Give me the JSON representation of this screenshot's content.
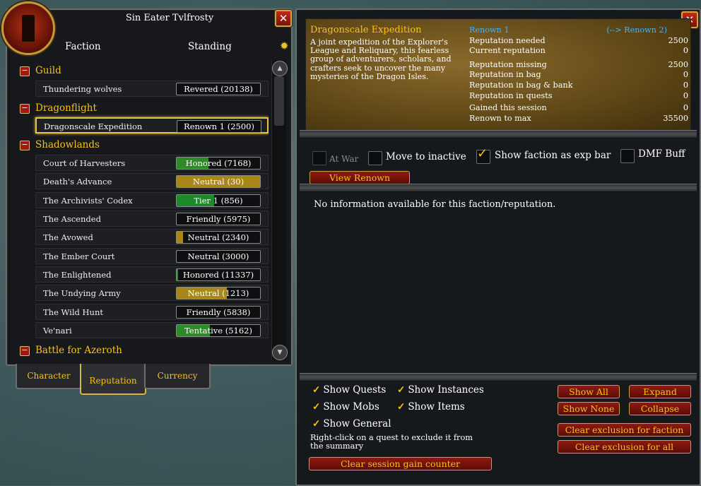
{
  "left": {
    "title": "Sin Eater Tvlfrosty",
    "col_faction": "Faction",
    "col_standing": "Standing",
    "categories": [
      {
        "label": "Guild"
      },
      {
        "label": "Dragonflight"
      },
      {
        "label": "Shadowlands"
      },
      {
        "label": "Battle for Azeroth"
      }
    ],
    "rows": [
      {
        "name": "Thundering wolves",
        "standing": "Revered (20138)",
        "fill": 0,
        "color": "#2f8a2a"
      },
      {
        "name": "Dragonscale Expedition",
        "standing": "Renown 1 (2500)",
        "fill": 0,
        "color": "#2f8a2a"
      },
      {
        "name": "Court of Harvesters",
        "standing": "Honored (7168)",
        "fill": 0.38,
        "color": "#2f8a2a"
      },
      {
        "name": "Death's Advance",
        "standing": "Neutral (30)",
        "fill": 1.0,
        "color": "#a8871a"
      },
      {
        "name": "The Archivists' Codex",
        "standing": "Tier 1 (856)",
        "fill": 0.45,
        "color": "#1c8a2a"
      },
      {
        "name": "The Ascended",
        "standing": "Friendly (5975)",
        "fill": 0,
        "color": "#2f8a2a"
      },
      {
        "name": "The Avowed",
        "standing": "Neutral (2340)",
        "fill": 0.08,
        "color": "#a8871a"
      },
      {
        "name": "The Ember Court",
        "standing": "Neutral (3000)",
        "fill": 0,
        "color": "#a8871a"
      },
      {
        "name": "The Enlightened",
        "standing": "Honored (11337)",
        "fill": 0.02,
        "color": "#2f8a2a"
      },
      {
        "name": "The Undying Army",
        "standing": "Neutral (1213)",
        "fill": 0.6,
        "color": "#a8871a"
      },
      {
        "name": "The Wild Hunt",
        "standing": "Friendly (5838)",
        "fill": 0,
        "color": "#2f8a2a"
      },
      {
        "name": "Ve'nari",
        "standing": "Tentative (5162)",
        "fill": 0.4,
        "color": "#2f8a2a"
      }
    ],
    "tabs": [
      "Character",
      "Reputation",
      "Currency"
    ]
  },
  "right": {
    "faction_title": "Dragonscale Expedition",
    "faction_desc": "A joint expedition of the Explorer's League and Reliquary, this fearless group of adventurers, scholars, and crafters seek to uncover the many mysteries of the Dragon Isles.",
    "renown_current": "Renown 1",
    "renown_next": "(--> Renown 2)",
    "stats": [
      {
        "label": "Reputation needed",
        "value": "2500"
      },
      {
        "label": "Current reputation",
        "value": "0"
      },
      {
        "label": "Reputation missing",
        "value": "2500"
      },
      {
        "label": "Reputation in bag",
        "value": "0"
      },
      {
        "label": "Reputation in bag & bank",
        "value": "0"
      },
      {
        "label": "Reputation in quests",
        "value": "0"
      },
      {
        "label": "Gained this session",
        "value": "0"
      },
      {
        "label": "Renown to max",
        "value": "35500"
      }
    ],
    "at_war": "At War",
    "move_inactive": "Move to inactive",
    "show_exp_bar": "Show faction as exp bar",
    "dmf_buff": "DMF Buff",
    "view_renown": "View Renown",
    "info": "No information available for this faction/reputation.",
    "show_quests": "Show Quests",
    "show_instances": "Show Instances",
    "show_mobs": "Show Mobs",
    "show_items": "Show Items",
    "show_general": "Show General",
    "note": "Right-click on a quest to exclude it from the summary",
    "show_all": "Show All",
    "expand": "Expand",
    "show_none": "Show None",
    "collapse": "Collapse",
    "clear_faction": "Clear exclusion for faction",
    "clear_all": "Clear exclusion for all",
    "clear_session": "Clear session gain counter"
  }
}
